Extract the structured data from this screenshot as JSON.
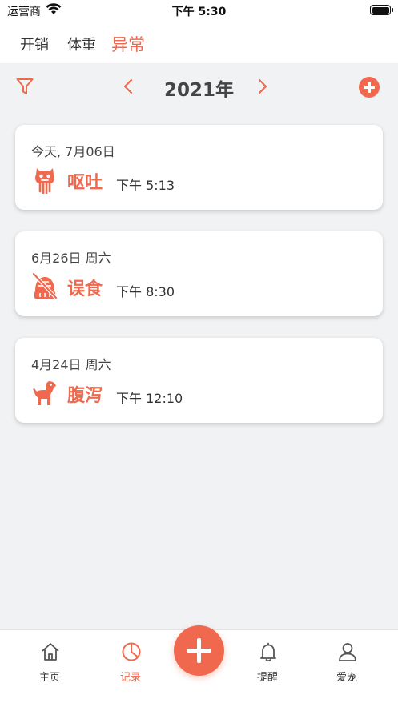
{
  "status_bar": {
    "carrier": "运营商",
    "time": "下午 5:30"
  },
  "top_tabs": [
    {
      "label": "开销",
      "active": false
    },
    {
      "label": "体重",
      "active": false
    },
    {
      "label": "异常",
      "active": true
    }
  ],
  "year_bar": {
    "title": "2021年"
  },
  "records": [
    {
      "date": "今天, 7月06日",
      "type": "呕吐",
      "time": "下午 5:13",
      "icon": "vomit-icon"
    },
    {
      "date": "6月26日 周六",
      "type": "误食",
      "time": "下午 8:30",
      "icon": "no-eat-icon"
    },
    {
      "date": "4月24日 周六",
      "type": "腹泻",
      "time": "下午 12:10",
      "icon": "dog-icon"
    }
  ],
  "tab_bar": {
    "items": [
      {
        "label": "主页",
        "icon": "home-icon",
        "active": false
      },
      {
        "label": "记录",
        "icon": "pie-chart-icon",
        "active": true
      },
      {
        "label": "提醒",
        "icon": "bell-icon",
        "active": false
      },
      {
        "label": "爱宠",
        "icon": "user-icon",
        "active": false
      }
    ]
  },
  "colors": {
    "accent": "#f0694e",
    "background": "#f0f2f4"
  }
}
